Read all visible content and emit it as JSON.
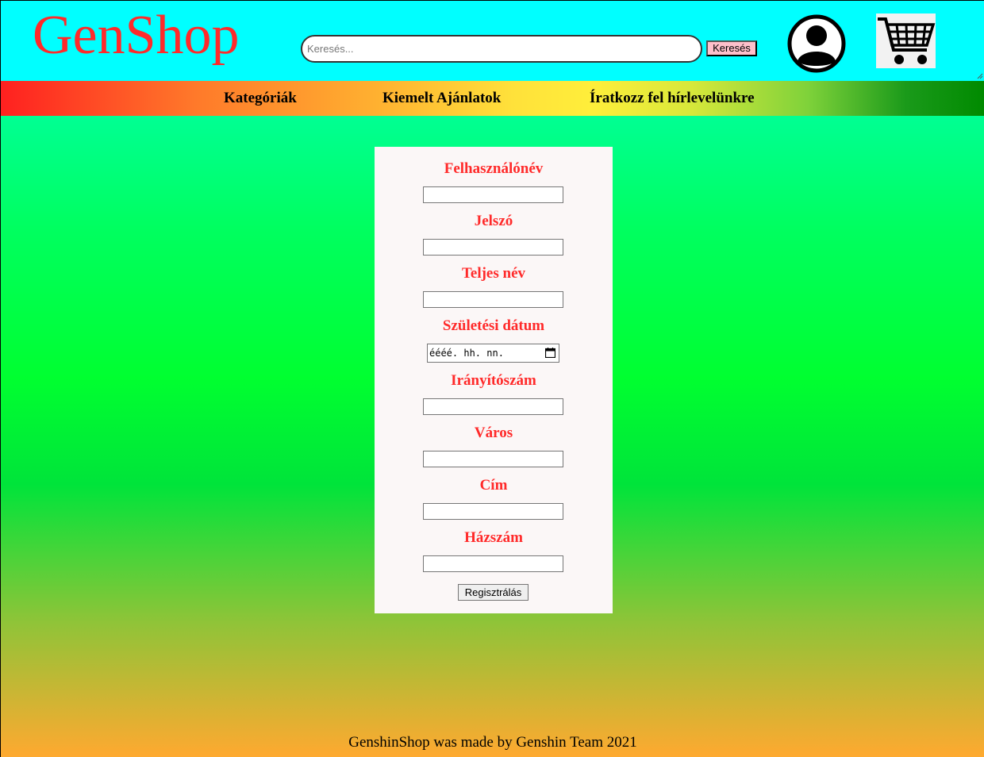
{
  "header": {
    "logo_text": "GenShop",
    "search": {
      "placeholder": "Keresés...",
      "value": ""
    },
    "search_button_label": "Keresés",
    "profile_icon": "user-avatar-icon",
    "cart_icon": "shopping-cart-icon"
  },
  "nav": {
    "items": [
      {
        "label": "Kategóriák"
      },
      {
        "label": "Kiemelt Ajánlatok"
      },
      {
        "label": "Íratkozz fel hírlevelünkre"
      }
    ]
  },
  "form": {
    "fields": [
      {
        "label": "Felhasználónév",
        "value": ""
      },
      {
        "label": "Jelszó",
        "value": ""
      },
      {
        "label": "Teljes név",
        "value": ""
      },
      {
        "label": "Születési dátum",
        "value": "éééé. hh. nn."
      },
      {
        "label": "Irányítószám",
        "value": ""
      },
      {
        "label": "Város",
        "value": ""
      },
      {
        "label": "Cím",
        "value": ""
      },
      {
        "label": "Házszám",
        "value": ""
      }
    ],
    "submit_label": "Regisztrálás"
  },
  "footer": {
    "text": "GenshinShop was made by Genshin Team 2021"
  },
  "colors": {
    "header_bg": "#00ffff",
    "logo": "#ff2a2a",
    "label": "#ff2a2a",
    "search_button_bg": "#ffc0cb",
    "panel_bg": "#fbf7f7"
  }
}
